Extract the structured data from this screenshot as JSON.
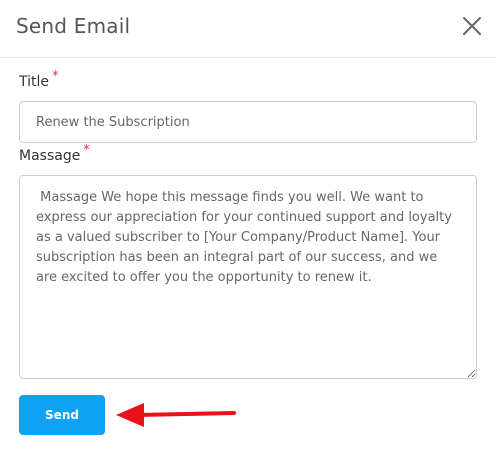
{
  "dialog": {
    "title": "Send Email",
    "close_icon": "close-icon"
  },
  "form": {
    "title_label": "Title",
    "title_required": "*",
    "title_value": "Renew the Subscription",
    "message_label": "Massage",
    "message_required": "*",
    "message_value": " Massage We hope this message finds you well. We want to express our appreciation for your continued support and loyalty as a valued subscriber to [Your Company/Product Name]. Your subscription has been an integral part of our success, and we are excited to offer you the opportunity to renew it.",
    "send_label": "Send"
  },
  "annotation": {
    "arrow_icon": "red-arrow-left-icon",
    "arrow_color": "#e8121b"
  },
  "colors": {
    "accent": "#10a3f5",
    "required": "#e5333b"
  }
}
